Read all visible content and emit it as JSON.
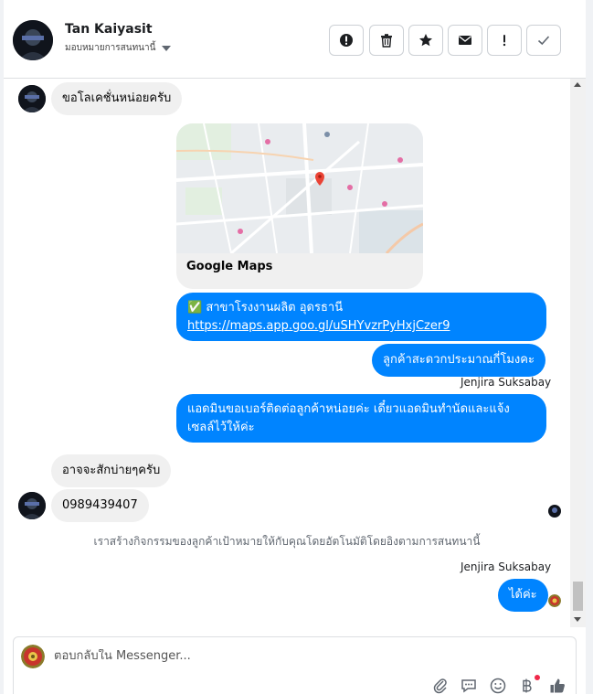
{
  "header": {
    "name": "Tan Kaiyasit",
    "assign_label": "มอบหมายการสนทนานี้",
    "tools": [
      {
        "icon": "alert-circle-icon"
      },
      {
        "icon": "trash-icon"
      },
      {
        "icon": "star-icon"
      },
      {
        "icon": "envelope-icon"
      },
      {
        "icon": "exclamation-icon"
      },
      {
        "icon": "checkmark-icon"
      }
    ]
  },
  "thread": {
    "messages": [
      {
        "text": "ขอโลเคชั่นหน่อยครับ",
        "direction": "incoming"
      },
      {
        "map_label": "Google Maps",
        "direction": "incoming"
      },
      {
        "text": "✅ สาขาโรงงานผลิต อุดรธานี",
        "link": "https://maps.app.goo.gl/uSHYvzrPyHxjCzer9",
        "direction": "outgoing"
      },
      {
        "text": "ลูกค้าสะดวกประมาณกี่โมงคะ",
        "direction": "outgoing"
      },
      {
        "sender": "Jenjira Suksabay"
      },
      {
        "text_line1": "แอดมินขอเบอร์ติดต่อลูกค้าหน่อยค่ะ เดี๋ยวแอดมินทำนัดและแจ้ง",
        "text_line2": "เซลล์ไว้ให้ค่ะ",
        "direction": "outgoing"
      },
      {
        "text": "อาจจะสักบ่ายๆครับ",
        "direction": "incoming"
      },
      {
        "text": "0989439407",
        "direction": "incoming"
      },
      {
        "system": "เราสร้างกิจกรรมของลูกค้าเป้าหมายให้กับคุณโดยอัตโนมัติโดยอิงตามการสนทนานี้"
      },
      {
        "sender": "Jenjira Suksabay"
      },
      {
        "text": "ได้ค่ะ",
        "direction": "outgoing"
      }
    ]
  },
  "composer": {
    "placeholder": "ตอบกลับใน Messenger...",
    "icons": [
      "paperclip-icon",
      "saved-reply-icon",
      "emoji-icon",
      "baht-icon",
      "thumbs-up-icon"
    ]
  },
  "colors": {
    "outgoing_bubble": "#0084ff",
    "incoming_bubble": "#f0f0f0",
    "notification_dot": "#f02849"
  }
}
